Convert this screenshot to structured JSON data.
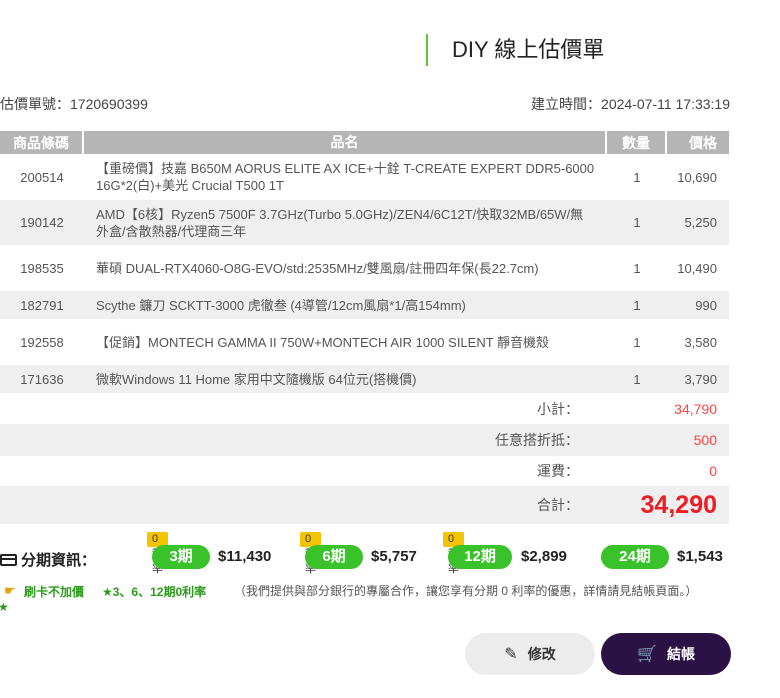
{
  "header": {
    "title": "DIY 線上估價單"
  },
  "meta": {
    "quote_no": "估價單號：1720690399",
    "created": "建立時間：2024-07-11 17:33:19"
  },
  "table": {
    "columns": [
      "商品條碼",
      "品名",
      "數量",
      "價格"
    ],
    "rows": [
      {
        "code": "200514",
        "name": "【重磅價】技嘉 B650M AORUS ELITE AX ICE+十銓 T-CREATE EXPERT DDR5-6000 16G*2(白)+美光 Crucial T500 1T",
        "qty": "1",
        "price": "10,690"
      },
      {
        "code": "190142",
        "name": "AMD【6核】Ryzen5 7500F 3.7GHz(Turbo 5.0GHz)/ZEN4/6C12T/快取32MB/65W/無外盒/含散熱器/代理商三年",
        "qty": "1",
        "price": "5,250"
      },
      {
        "code": "198535",
        "name": "華碩 DUAL-RTX4060-O8G-EVO/std:2535MHz/雙風扇/註冊四年保(長22.7cm)",
        "qty": "1",
        "price": "10,490"
      },
      {
        "code": "182791",
        "name": "Scythe 鐮刀 SCKTT-3000 虎徹叁 (4導管/12cm風扇*1/高154mm)",
        "qty": "1",
        "price": "990"
      },
      {
        "code": "192558",
        "name": "【促銷】MONTECH GAMMA II 750W+MONTECH AIR 1000 SILENT 靜音機殼",
        "qty": "1",
        "price": "3,580"
      },
      {
        "code": "171636",
        "name": "微軟Windows 11 Home 家用中文隨機版 64位元(搭機價)",
        "qty": "1",
        "price": "3,790"
      }
    ]
  },
  "summary": {
    "subtotal_label": "小計：",
    "subtotal": "34,790",
    "discount_label": "任意搭折抵：",
    "discount": "500",
    "shipping_label": "運費：",
    "shipping": "0",
    "total_label": "合計：",
    "total": "34,290"
  },
  "installments": {
    "title": "分期資訊：",
    "plans": [
      {
        "badge": "0利率",
        "period": "3期",
        "amount": "$11,430"
      },
      {
        "badge": "0利率",
        "period": "6期",
        "amount": "$5,757"
      },
      {
        "badge": "0利率",
        "period": "12期",
        "amount": "$2,899"
      },
      {
        "badge": "",
        "period": "24期",
        "amount": "$1,543"
      }
    ]
  },
  "notes": {
    "card": "刷卡不加價",
    "zero_rate": "★3、6、12期0利率",
    "star": "★",
    "detail": "（我們提供與部分銀行的專屬合作，讓您享有分期 0 利率的優惠，詳情請見結帳頁面。）"
  },
  "buttons": {
    "edit": "修改",
    "checkout": "結帳"
  },
  "colors": {
    "accent_green": "#3ac22a",
    "checkout_bg": "#2a1245",
    "total_red": "#ee1d23"
  }
}
